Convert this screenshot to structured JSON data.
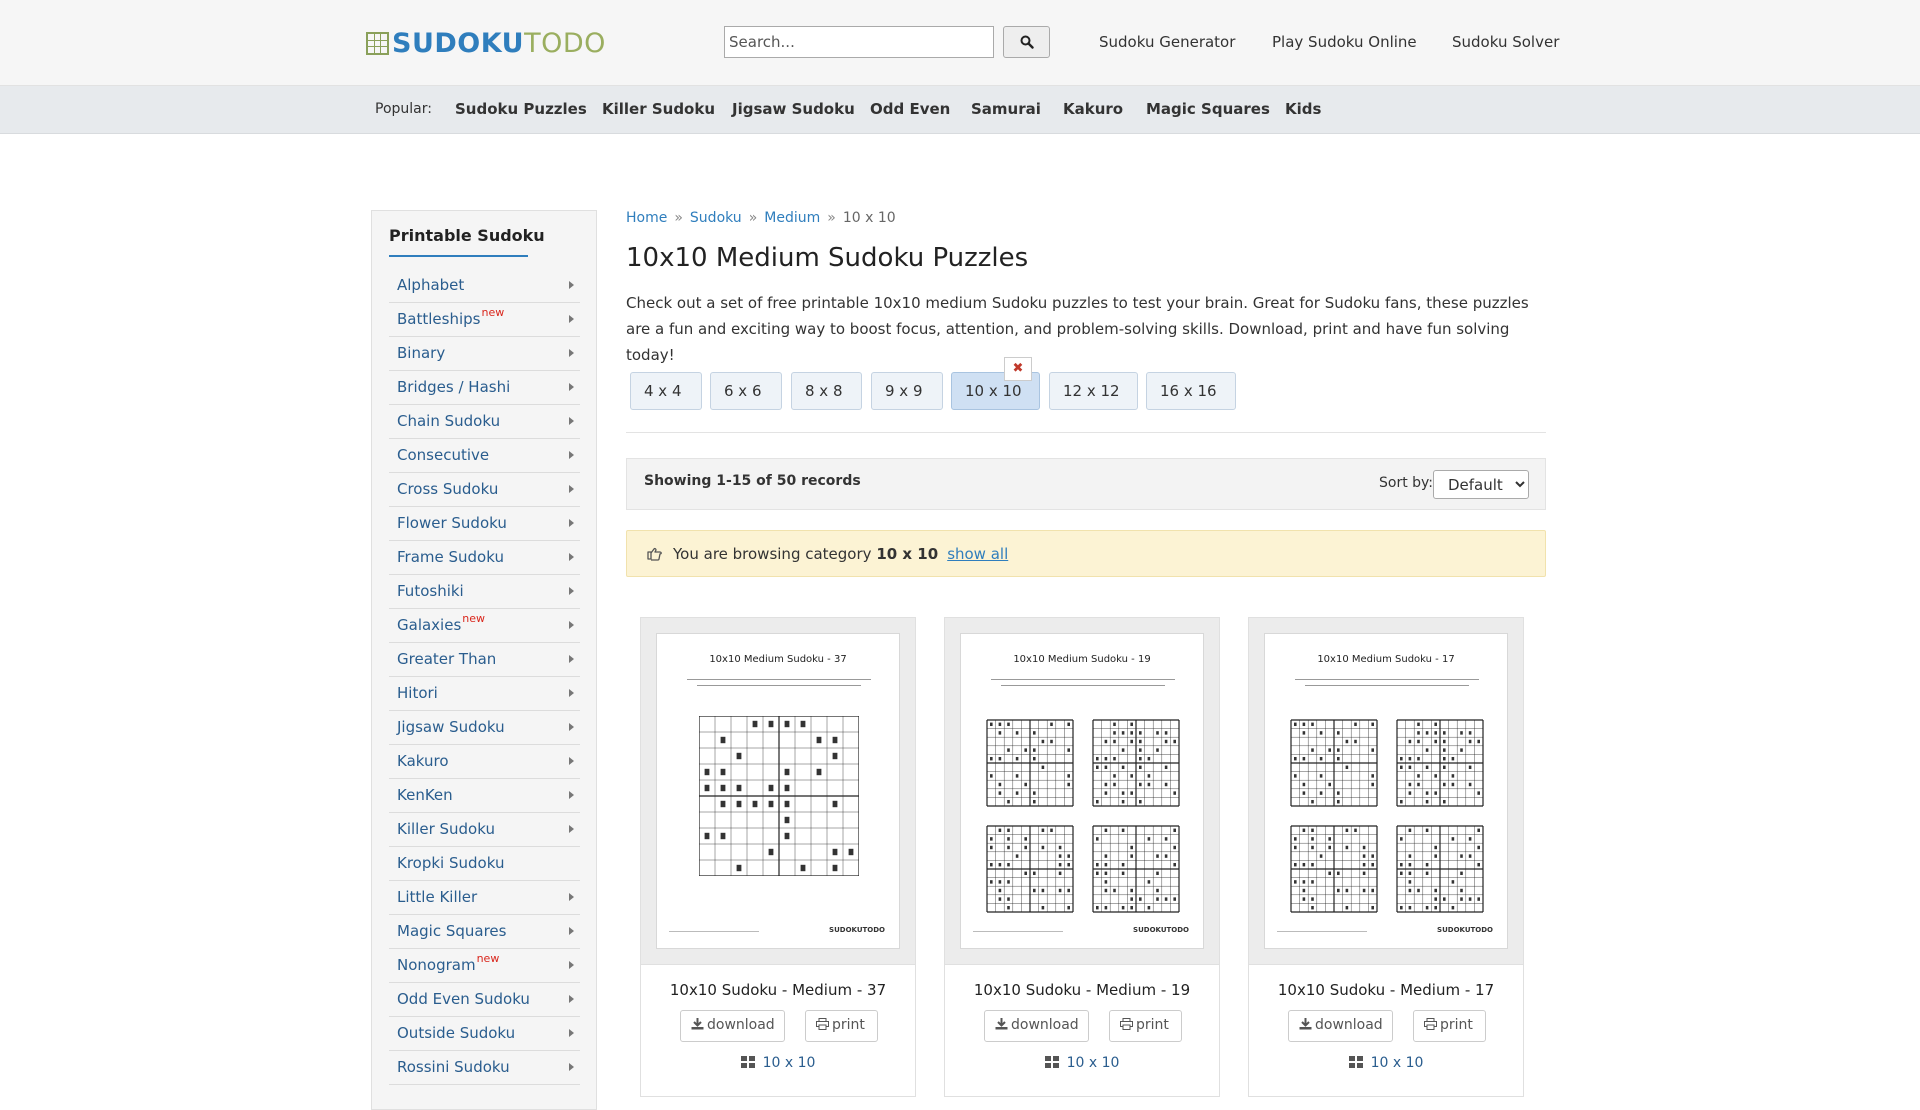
{
  "header": {
    "logo_a": "SUDOKU",
    "logo_b": "TODO",
    "search_placeholder": "Search...",
    "nav": [
      "Sudoku Generator",
      "Play Sudoku Online",
      "Sudoku Solver"
    ]
  },
  "popular": {
    "label": "Popular:",
    "items": [
      "Sudoku Puzzles",
      "Killer Sudoku",
      "Jigsaw Sudoku",
      "Odd Even",
      "Samurai",
      "Kakuro",
      "Magic Squares",
      "Kids"
    ]
  },
  "sidebar": {
    "title": "Printable Sudoku",
    "items": [
      {
        "label": "Alphabet",
        "new": ""
      },
      {
        "label": "Battleships",
        "new": "new"
      },
      {
        "label": "Binary",
        "new": ""
      },
      {
        "label": "Bridges / Hashi",
        "new": ""
      },
      {
        "label": "Chain Sudoku",
        "new": ""
      },
      {
        "label": "Consecutive",
        "new": ""
      },
      {
        "label": "Cross Sudoku",
        "new": ""
      },
      {
        "label": "Flower Sudoku",
        "new": ""
      },
      {
        "label": "Frame Sudoku",
        "new": ""
      },
      {
        "label": "Futoshiki",
        "new": ""
      },
      {
        "label": "Galaxies",
        "new": "new"
      },
      {
        "label": "Greater Than",
        "new": ""
      },
      {
        "label": "Hitori",
        "new": ""
      },
      {
        "label": "Jigsaw Sudoku",
        "new": ""
      },
      {
        "label": "Kakuro",
        "new": ""
      },
      {
        "label": "KenKen",
        "new": ""
      },
      {
        "label": "Killer Sudoku",
        "new": ""
      },
      {
        "label": "Kropki Sudoku",
        "new": ""
      },
      {
        "label": "Little Killer",
        "new": ""
      },
      {
        "label": "Magic Squares",
        "new": ""
      },
      {
        "label": "Nonogram",
        "new": "new"
      },
      {
        "label": "Odd Even Sudoku",
        "new": ""
      },
      {
        "label": "Outside Sudoku",
        "new": ""
      },
      {
        "label": "Rossini Sudoku",
        "new": ""
      }
    ]
  },
  "breadcrumb": {
    "items": [
      "Home",
      "Sudoku",
      "Medium"
    ],
    "sep": "»",
    "current": "10 x 10"
  },
  "main": {
    "title": "10x10 Medium Sudoku Puzzles",
    "intro": "Check out a set of free printable 10x10 medium Sudoku puzzles to test your brain. Great for Sudoku fans, these puzzles are a fun and exciting way to boost focus, attention, and problem-solving skills. Download, print and have fun solving today!",
    "sizes": [
      "4 x 4",
      "6 x 6",
      "8 x 8",
      "9 x 9",
      "10 x 10",
      "12 x 12",
      "16 x 16"
    ],
    "active_size": "10 x 10",
    "clear_symbol": "✖",
    "showing": "Showing 1-15 of 50 records",
    "sort_label": "Sort by:",
    "sort_value": "Default",
    "notice_prefix": "You are browsing category",
    "notice_category": "10 x 10",
    "show_all": "show all"
  },
  "cards": [
    {
      "name": "10x10 Sudoku - Medium - 37",
      "sheet_title": "10x10 Medium Sudoku - 37",
      "download": "download",
      "print": "print",
      "category": "10 x 10"
    },
    {
      "name": "10x10 Sudoku - Medium - 19",
      "sheet_title": "10x10 Medium Sudoku - 19",
      "download": "download",
      "print": "print",
      "category": "10 x 10"
    },
    {
      "name": "10x10 Sudoku - Medium - 17",
      "sheet_title": "10x10 Medium Sudoku - 17",
      "download": "download",
      "print": "print",
      "category": "10 x 10"
    }
  ],
  "sheet_brand": "SUDOKUTODO",
  "colors": {
    "link": "#2f7ebd",
    "logo_blue": "#2f7ebd",
    "logo_green": "#9aae5f",
    "new_badge": "#d9261c",
    "notice_bg": "#fcf3d4",
    "active_size_bg": "#cfe0f3"
  }
}
